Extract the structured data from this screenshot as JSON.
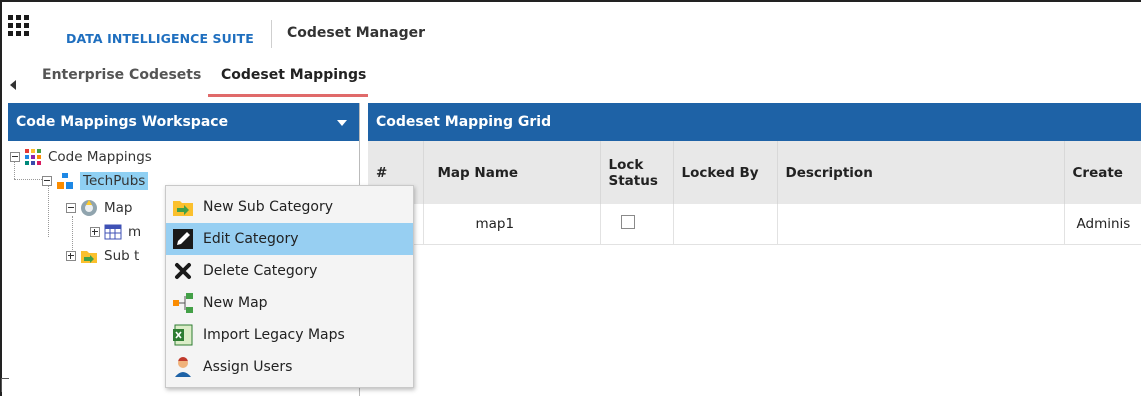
{
  "header": {
    "app_name": "DATA INTELLIGENCE SUITE",
    "module_name": "Codeset Manager"
  },
  "tabs": [
    {
      "label": "Enterprise Codesets",
      "active": false
    },
    {
      "label": "Codeset Mappings",
      "active": true
    }
  ],
  "workspace": {
    "title": "Code Mappings Workspace",
    "tree": {
      "root": "Code Mappings",
      "category": "TechPubs",
      "maps_folder": "Map",
      "map_item": "m",
      "sub_folder": "Sub t"
    }
  },
  "grid": {
    "title": "Codeset Mapping Grid",
    "columns": [
      "#",
      "Map Name",
      "Lock Status",
      "Locked By",
      "Description",
      "Create"
    ],
    "rows": [
      {
        "num": "",
        "map_name": "map1",
        "locked": false,
        "locked_by": "",
        "description": "",
        "created_by": "Adminis"
      }
    ]
  },
  "context_menu": {
    "items": [
      {
        "label": "New Sub Category",
        "icon": "new-sub-category-icon",
        "highlighted": false
      },
      {
        "label": "Edit Category",
        "icon": "edit-pencil-icon",
        "highlighted": true
      },
      {
        "label": "Delete Category",
        "icon": "delete-x-icon",
        "highlighted": false
      },
      {
        "label": "New Map",
        "icon": "new-map-icon",
        "highlighted": false
      },
      {
        "label": "Import Legacy Maps",
        "icon": "excel-import-icon",
        "highlighted": false
      },
      {
        "label": "Assign Users",
        "icon": "user-icon",
        "highlighted": false
      }
    ]
  },
  "colors": {
    "panel_header": "#1e62a6",
    "brand_text": "#1f6fbf",
    "tab_underline": "#e06a6a",
    "selection": "#97cff2"
  }
}
